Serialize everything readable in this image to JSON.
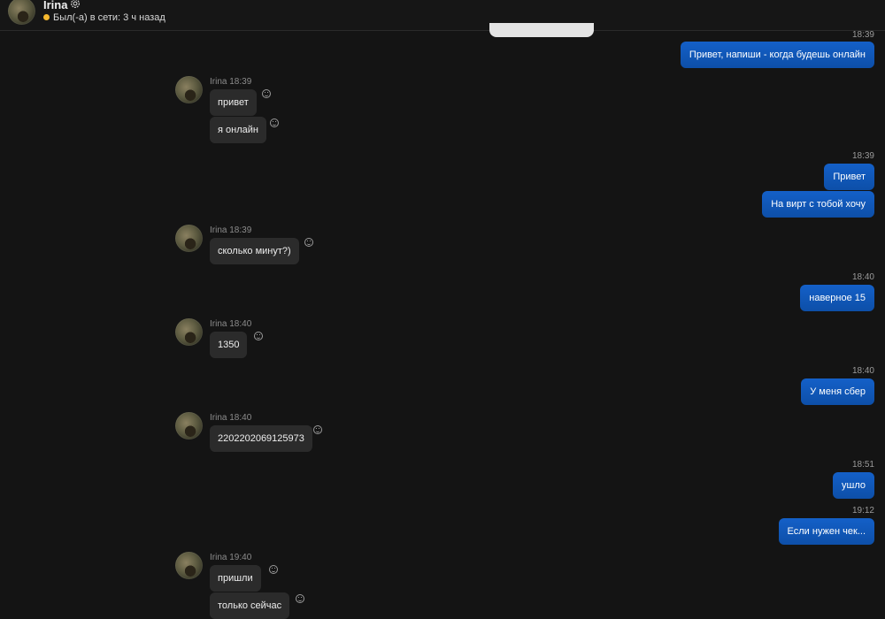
{
  "header": {
    "name": "Irina",
    "status": "Был(-а) в сети: 3 ч назад",
    "status_color": "#f5b82e"
  },
  "colors": {
    "background": "#141414",
    "incoming_bubble": "#2b2b2b",
    "outgoing_bubble": "#1460c8"
  },
  "messages": {
    "o1": {
      "time": "18:39",
      "text": "Привет, напиши - когда будешь онлайн"
    },
    "i1": {
      "sender": "Irina",
      "time": "18:39",
      "text1": "привет",
      "text2": "я онлайн"
    },
    "o2": {
      "time": "18:39",
      "text1": "Привет",
      "text2": "На вирт с тобой хочу"
    },
    "i2": {
      "sender": "Irina",
      "time": "18:39",
      "text": "сколько минут?)"
    },
    "o3": {
      "time": "18:40",
      "text": "наверное 15"
    },
    "i3": {
      "sender": "Irina",
      "time": "18:40",
      "text": "1350"
    },
    "o4": {
      "time": "18:40",
      "text": "У меня сбер"
    },
    "i4": {
      "sender": "Irina",
      "time": "18:40",
      "text": "2202202069125973"
    },
    "o5": {
      "time": "18:51",
      "text": "ушло"
    },
    "o6": {
      "time": "19:12",
      "text": "Если нужен чек..."
    },
    "i5": {
      "sender": "Irina",
      "time": "19:40",
      "text1": "пришли",
      "text2": "только сейчас"
    }
  }
}
